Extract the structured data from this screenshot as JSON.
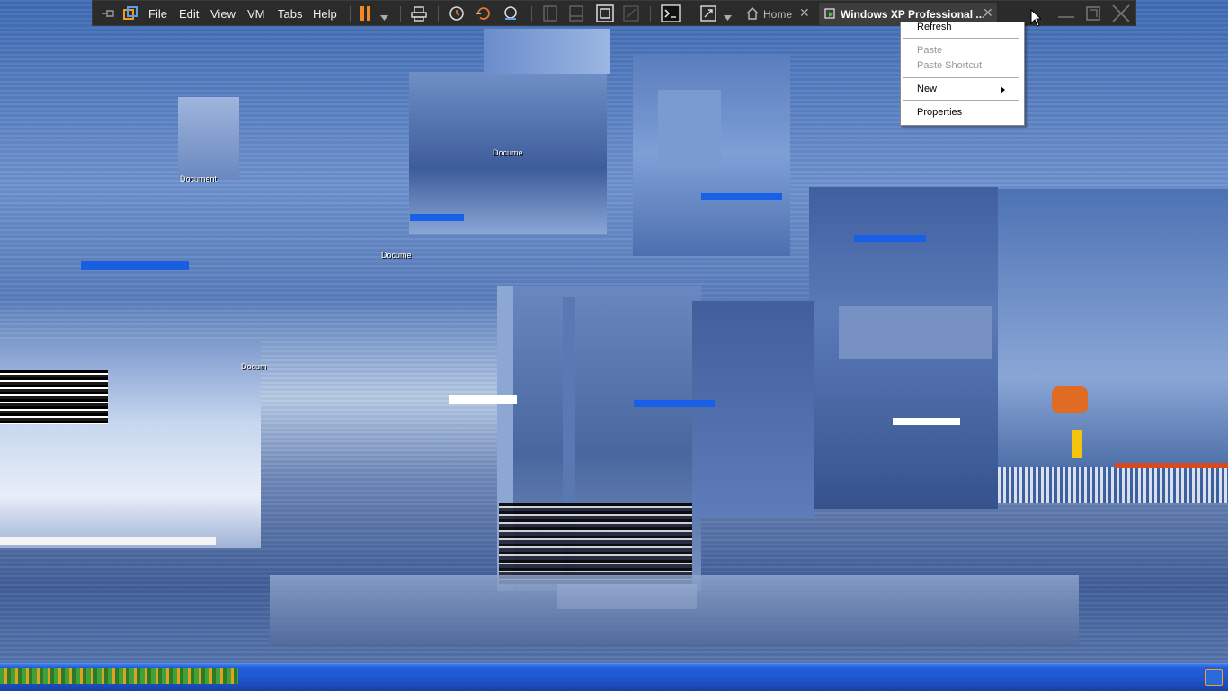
{
  "toolbar": {
    "menus": [
      "File",
      "Edit",
      "View",
      "VM",
      "Tabs",
      "Help"
    ],
    "tabs": [
      {
        "label": "Home",
        "icon": "home-icon"
      },
      {
        "label": "Windows XP Professional ...",
        "icon": "vm-running-icon"
      }
    ],
    "icons": [
      "pin-icon",
      "vmware-logo-icon",
      "pause-icon",
      "dropdown-arrow-icon",
      "send-ctrl-alt-del-icon",
      "snapshot-icon",
      "revert-snapshot-icon",
      "snapshot-manager-icon",
      "library-view-icon",
      "thumbnail-view-icon",
      "fit-guest-icon",
      "unity-icon",
      "console-icon",
      "fullscreen-icon",
      "close-tab-icon"
    ]
  },
  "context_menu": {
    "items": [
      {
        "label": "Refresh",
        "enabled": true
      },
      {
        "label": "Paste",
        "enabled": false
      },
      {
        "label": "Paste Shortcut",
        "enabled": false
      },
      {
        "label": "New",
        "enabled": true,
        "submenu": true
      },
      {
        "label": "Properties",
        "enabled": true
      }
    ]
  },
  "desktop": {
    "icon_labels": [
      "Document",
      "Docume",
      "Docume",
      "Docum"
    ]
  },
  "window_controls": [
    "minimize-icon",
    "restore-icon",
    "close-icon"
  ],
  "colors": {
    "toolbar_bg": "#2b2b2b",
    "pause_orange": "#f08a24",
    "taskbar_blue": "#245edb",
    "desktop_blue": "#4a73b5"
  }
}
